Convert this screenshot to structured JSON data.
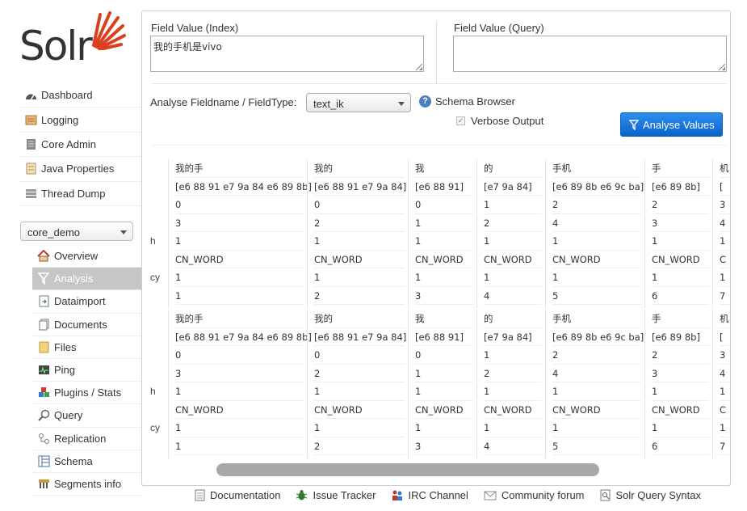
{
  "app": {
    "logo_text": "Solr"
  },
  "nav": {
    "main": [
      {
        "label": "Dashboard",
        "icon": "dashboard-icon"
      },
      {
        "label": "Logging",
        "icon": "logging-icon"
      },
      {
        "label": "Core Admin",
        "icon": "core-admin-icon"
      },
      {
        "label": "Java Properties",
        "icon": "java-icon"
      },
      {
        "label": "Thread Dump",
        "icon": "thread-dump-icon"
      }
    ],
    "core_selector": "core_demo",
    "core": [
      {
        "label": "Overview",
        "icon": "overview-icon"
      },
      {
        "label": "Analysis",
        "icon": "analysis-icon"
      },
      {
        "label": "Dataimport",
        "icon": "dataimport-icon"
      },
      {
        "label": "Documents",
        "icon": "documents-icon"
      },
      {
        "label": "Files",
        "icon": "files-icon"
      },
      {
        "label": "Ping",
        "icon": "ping-icon"
      },
      {
        "label": "Plugins / Stats",
        "icon": "plugins-icon"
      },
      {
        "label": "Query",
        "icon": "query-icon"
      },
      {
        "label": "Replication",
        "icon": "replication-icon"
      },
      {
        "label": "Schema",
        "icon": "schema-icon"
      },
      {
        "label": "Segments info",
        "icon": "segments-icon"
      }
    ]
  },
  "analysis": {
    "index_label": "Field Value (Index)",
    "index_value": "我的手机是vivo",
    "query_label": "Field Value (Query)",
    "query_value": "",
    "fieldtype_label": "Analyse Fieldname / FieldType:",
    "fieldtype_value": "text_ik",
    "schema_browser": "Schema Browser",
    "verbose_label": "Verbose Output",
    "verbose_checked": true,
    "analyse_button": "Analyse Values"
  },
  "row_labels": [
    "",
    "",
    "",
    "",
    "h",
    "",
    "cy",
    ""
  ],
  "tokens": [
    {
      "text": "我的手",
      "raw_bytes": "[e6 88 91 e7 9a 84 e6 89 8b]",
      "start": "0",
      "end": "3",
      "position_length": "1",
      "type": "CN_WORD",
      "term_frequency": "1",
      "position": "1"
    },
    {
      "text": "我的",
      "raw_bytes": "[e6 88 91 e7 9a 84]",
      "start": "0",
      "end": "2",
      "position_length": "1",
      "type": "CN_WORD",
      "term_frequency": "1",
      "position": "2"
    },
    {
      "text": "我",
      "raw_bytes": "[e6 88 91]",
      "start": "0",
      "end": "1",
      "position_length": "1",
      "type": "CN_WORD",
      "term_frequency": "1",
      "position": "3"
    },
    {
      "text": "的",
      "raw_bytes": "[e7 9a 84]",
      "start": "1",
      "end": "2",
      "position_length": "1",
      "type": "CN_WORD",
      "term_frequency": "1",
      "position": "4"
    },
    {
      "text": "手机",
      "raw_bytes": "[e6 89 8b e6 9c ba]",
      "start": "2",
      "end": "4",
      "position_length": "1",
      "type": "CN_WORD",
      "term_frequency": "1",
      "position": "5"
    },
    {
      "text": "手",
      "raw_bytes": "[e6 89 8b]",
      "start": "2",
      "end": "3",
      "position_length": "1",
      "type": "CN_WORD",
      "term_frequency": "1",
      "position": "6"
    },
    {
      "text": "机",
      "raw_bytes": "[",
      "start": "3",
      "end": "4",
      "position_length": "1",
      "type": "C",
      "term_frequency": "1",
      "position": "7"
    }
  ],
  "footer": [
    {
      "label": "Documentation",
      "icon": "documentation-icon"
    },
    {
      "label": "Issue Tracker",
      "icon": "bug-icon"
    },
    {
      "label": "IRC Channel",
      "icon": "irc-icon"
    },
    {
      "label": "Community forum",
      "icon": "mail-icon"
    },
    {
      "label": "Solr Query Syntax",
      "icon": "query-syntax-icon"
    }
  ]
}
